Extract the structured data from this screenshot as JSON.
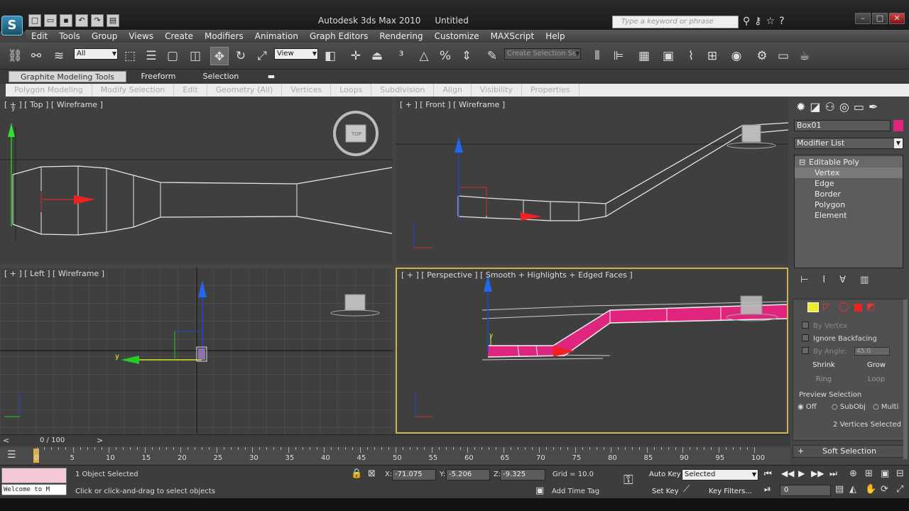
{
  "app": {
    "logo_glyph": "S",
    "title": "Autodesk 3ds Max 2010",
    "document": "Untitled",
    "search_placeholder": "Type a keyword or phrase"
  },
  "menu": [
    "Edit",
    "Tools",
    "Group",
    "Views",
    "Create",
    "Modifiers",
    "Animation",
    "Graph Editors",
    "Rendering",
    "Customize",
    "MAXScript",
    "Help"
  ],
  "toolbar": {
    "selection_filter": "All",
    "reference_coord": "View",
    "named_selection_placeholder": "Create Selection Se"
  },
  "ribbon": {
    "tabs": [
      "Graphite Modeling Tools",
      "Freeform",
      "Selection"
    ],
    "panels": [
      "Polygon Modeling",
      "Modify Selection",
      "Edit",
      "Geometry (All)",
      "Vertices",
      "Loops",
      "Subdivision",
      "Align",
      "Visibility",
      "Properties"
    ]
  },
  "viewports": {
    "top": "[ + ] [ Top ] [ Wireframe ]",
    "front": "[ + ] [ Front ] [ Wireframe ]",
    "left": "[ + ] [ Left ] [ Wireframe ]",
    "perspective": "[ + ] [ Perspective ] [ Smooth + Highlights + Edged Faces ]",
    "viewcube_top": "TOP",
    "axis_y": "y",
    "object_color": "#e0257f"
  },
  "command_panel": {
    "object_name": "Box01",
    "modifier_list": "Modifier List",
    "stack": {
      "root": "Editable Poly",
      "items": [
        "Vertex",
        "Edge",
        "Border",
        "Polygon",
        "Element"
      ]
    },
    "selection": {
      "by_vertex": "By Vertex",
      "ignore_backfacing": "Ignore Backfacing",
      "by_angle": "By Angle:",
      "angle_value": "45.0",
      "shrink": "Shrink",
      "grow": "Grow",
      "ring": "Ring",
      "loop": "Loop",
      "preview_selection": "Preview Selection",
      "off": "Off",
      "subobj": "SubObj",
      "multi": "Multi",
      "status": "2 Vertices Selected"
    },
    "soft_selection": "Soft Selection"
  },
  "timeline": {
    "frame_display": "0 / 100",
    "ticks": [
      "0",
      "5",
      "10",
      "15",
      "20",
      "25",
      "30",
      "35",
      "40",
      "45",
      "50",
      "55",
      "60",
      "65",
      "70",
      "75",
      "80",
      "85",
      "90",
      "95",
      "100"
    ]
  },
  "status": {
    "welcome": "Welcome to M",
    "selected": "1 Object Selected",
    "prompt": "Click or click-and-drag to select objects",
    "x_label": "X:",
    "x": "-71.075",
    "y_label": "Y:",
    "y": "-5.206",
    "z_label": "Z:",
    "z": "-9.325",
    "grid": "Grid = 10.0",
    "add_time_tag": "Add Time Tag",
    "auto_key": "Auto Key",
    "set_key": "Set Key",
    "key_mode": "Selected",
    "key_filters": "Key Filters...",
    "frame": "0"
  }
}
